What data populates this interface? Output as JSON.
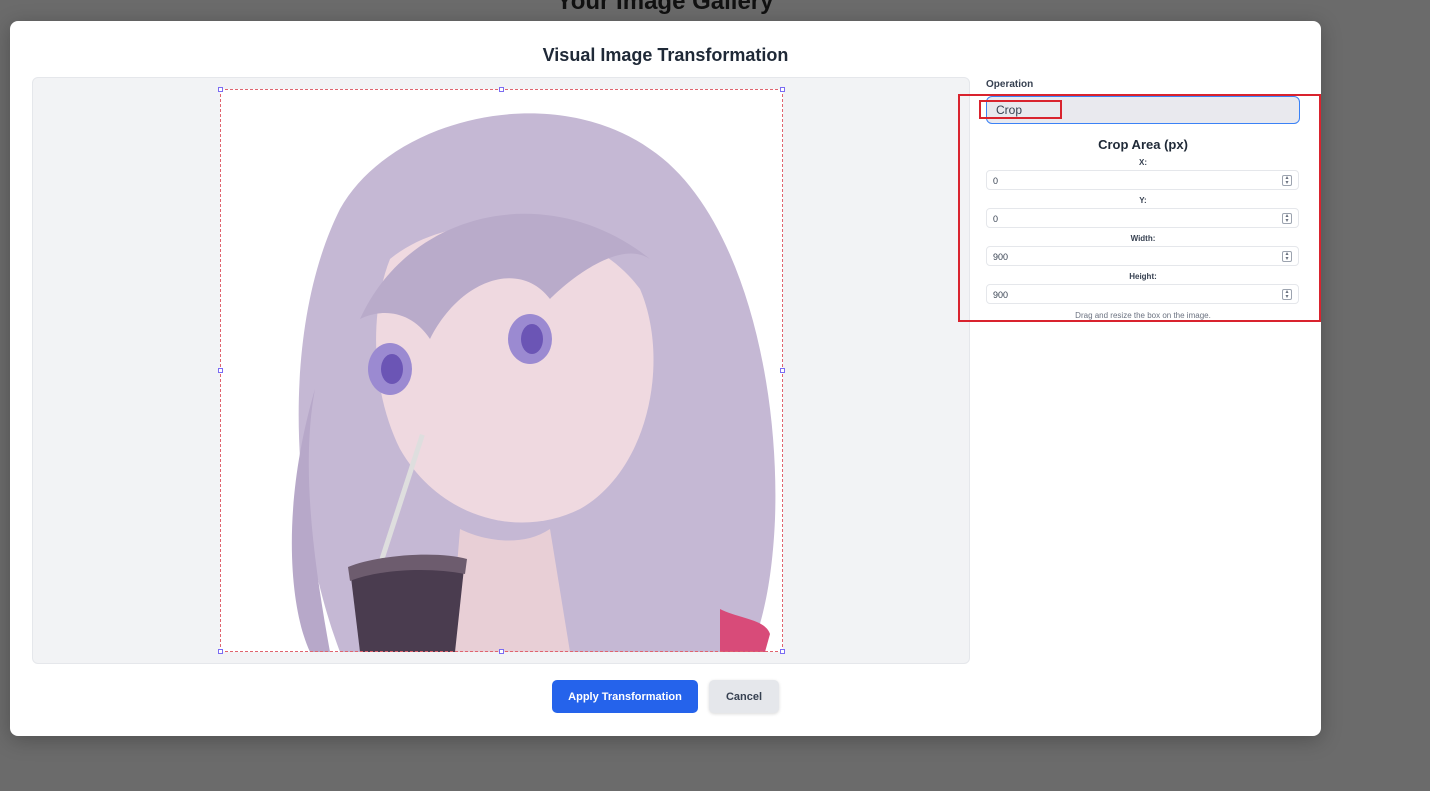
{
  "page": {
    "background_title": "Your Image Gallery"
  },
  "modal": {
    "title": "Visual Image Transformation",
    "operation": {
      "label": "Operation",
      "value": "Crop"
    },
    "crop": {
      "title": "Crop Area (px)",
      "fields": [
        {
          "label": "X:",
          "value": "0"
        },
        {
          "label": "Y:",
          "value": "0"
        },
        {
          "label": "Width:",
          "value": "900"
        },
        {
          "label": "Height:",
          "value": "900"
        }
      ],
      "hint": "Drag and resize the box on the image."
    },
    "apply_label": "Apply Transformation",
    "cancel_label": "Cancel"
  },
  "colors": {
    "accent": "#2563eb",
    "highlight": "#d9232e",
    "crop_border": "#e0646f",
    "overlay": "#6b6b6b"
  },
  "icons": {
    "spinner": "stepper-icon",
    "image": "anime-girl-illustration"
  }
}
